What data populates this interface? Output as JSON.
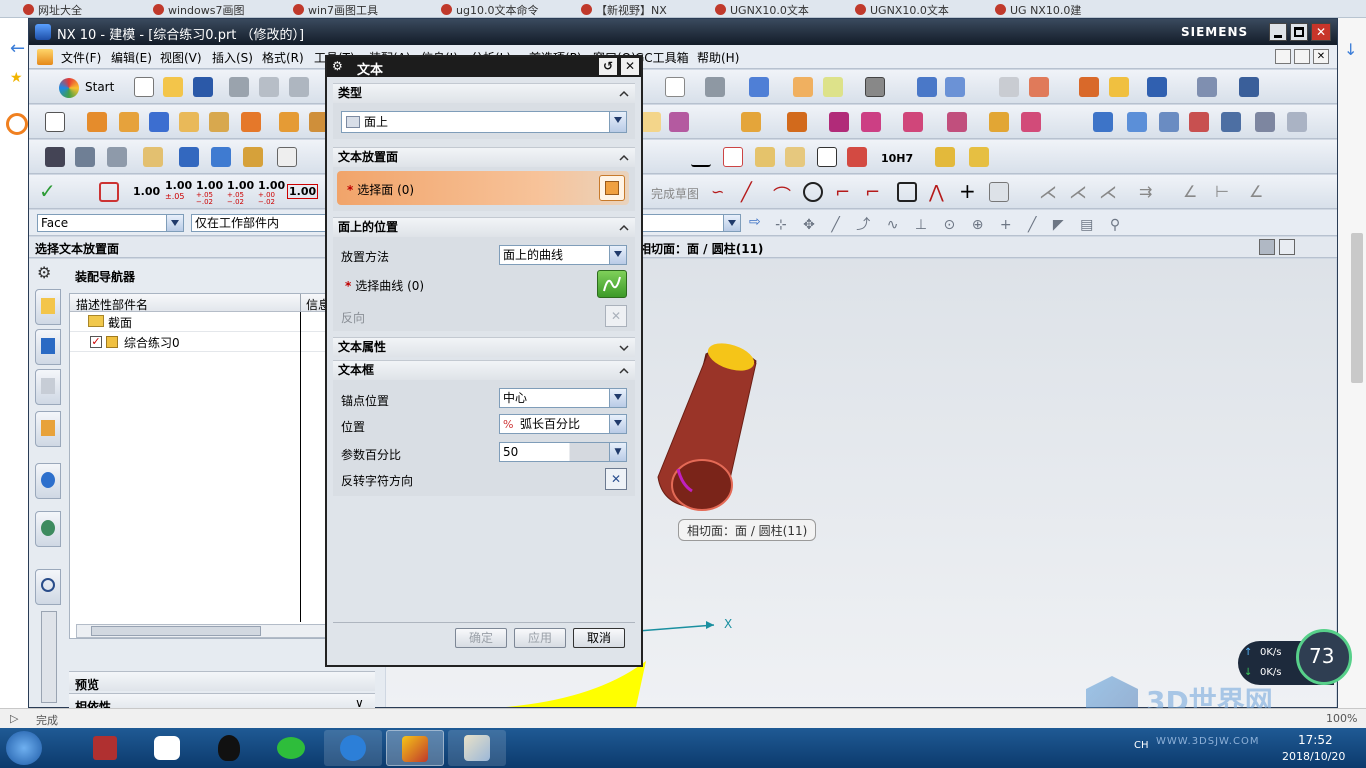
{
  "browser": {
    "tabs": [
      "网址大全",
      "windows7画图",
      "win7画图工具",
      "ug10.0文本命令",
      "【新视野】NX",
      "UGNX10.0文本",
      "UGNX10.0文本",
      "UG NX10.0建"
    ],
    "status": "完成",
    "zoom": "100%"
  },
  "window": {
    "title": "NX 10 - 建模 - [综合练习0.prt （修改的）]",
    "brand": "SIEMENS"
  },
  "menu": [
    "文件(F)",
    "编辑(E)",
    "视图(V)",
    "插入(S)",
    "格式(R)",
    "工具(T)",
    "装配(A)",
    "信息(I)",
    "分析(L)",
    "首选项(P)",
    "窗口(O)",
    "GC工具箱",
    "帮助(H)"
  ],
  "toolbar": {
    "start_label": "Start",
    "decimal_values": [
      "1.00",
      "1.00",
      "1.00",
      "1.00",
      "1.00",
      "1.00"
    ],
    "decimal_tols": [
      "",
      "±.05",
      "+.05 −.02",
      "+.05 −.02",
      "+.00 −.02",
      ""
    ],
    "sketch_label": "完成草图",
    "dim_label": "10H7"
  },
  "selection_bar": {
    "filter": "Face",
    "scope": "仅在工作部件内"
  },
  "prompt": "选择文本放置面",
  "graphics_status": "相切面：面 / 圆柱(11)",
  "navigator": {
    "title": "装配导航器",
    "columns": [
      "描述性部件名",
      "信息"
    ],
    "rows": [
      {
        "name": "截面"
      },
      {
        "name": "综合练习0"
      }
    ],
    "bottom_panels": [
      "预览",
      "相依性"
    ]
  },
  "dialog": {
    "title": "文本",
    "groups": {
      "type": {
        "label": "类型",
        "value": "面上"
      },
      "placement_face": {
        "label": "文本放置面",
        "select_label": "选择面 (0)"
      },
      "position": {
        "label": "面上的位置",
        "method_label": "放置方法",
        "method_value": "面上的曲线",
        "curve_label": "选择曲线 (0)",
        "reverse_label": "反向"
      },
      "text_props": {
        "label": "文本属性"
      },
      "text_box": {
        "label": "文本框",
        "anchor_label": "锚点位置",
        "anchor_value": "中心",
        "pos_label": "位置",
        "pos_value": "弧长百分比",
        "param_label": "参数百分比",
        "param_value": "50",
        "flip_label": "反转字符方向"
      }
    },
    "buttons": {
      "ok": "确定",
      "apply": "应用",
      "cancel": "取消"
    }
  },
  "tooltip": "相切面：面 / 圆柱(11)",
  "axis_label": "X",
  "net_monitor": {
    "up": "0K/s",
    "down": "0K/s",
    "cpu": "73"
  },
  "watermark": {
    "brand": "3D世界网",
    "url": "WWW.3DSJW.COM"
  },
  "taskbar": {
    "ime": "CH",
    "time": "17:52",
    "date": "2018/10/20"
  },
  "colors": {
    "dialog_highlight": "#f1a46a",
    "cylinder": "#8b2e22",
    "cylinder_top": "#f5c518",
    "title_bg": "#1c1c1c"
  }
}
